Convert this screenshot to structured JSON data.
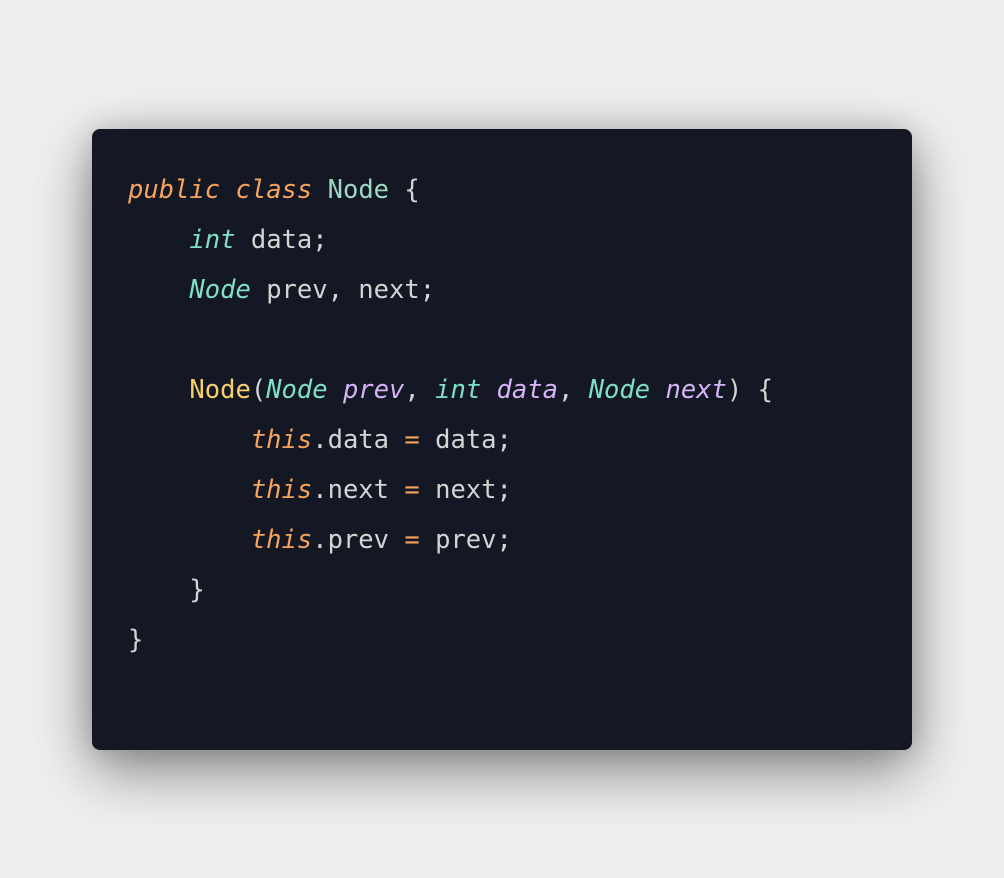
{
  "colors": {
    "background": "#141824",
    "keyword": "#f7a35c",
    "class": "#9dd8c2",
    "type": "#7fe0c6",
    "function": "#f8cf6a",
    "parameter": "#d7b3f7",
    "plain": "#d4d4d4"
  },
  "code_lines": [
    [
      [
        "keyword",
        "public"
      ],
      [
        "plain",
        " "
      ],
      [
        "keyword",
        "class"
      ],
      [
        "plain",
        " "
      ],
      [
        "class",
        "Node"
      ],
      [
        "plain",
        " {"
      ]
    ],
    [
      [
        "plain",
        "    "
      ],
      [
        "type",
        "int"
      ],
      [
        "plain",
        " data;"
      ]
    ],
    [
      [
        "plain",
        "    "
      ],
      [
        "type",
        "Node"
      ],
      [
        "plain",
        " prev, next;"
      ]
    ],
    [],
    [
      [
        "plain",
        "    "
      ],
      [
        "func",
        "Node"
      ],
      [
        "plain",
        "("
      ],
      [
        "type",
        "Node"
      ],
      [
        "plain",
        " "
      ],
      [
        "param",
        "prev"
      ],
      [
        "plain",
        ", "
      ],
      [
        "type",
        "int"
      ],
      [
        "plain",
        " "
      ],
      [
        "param",
        "data"
      ],
      [
        "plain",
        ", "
      ],
      [
        "type",
        "Node"
      ],
      [
        "plain",
        " "
      ],
      [
        "param",
        "next"
      ],
      [
        "plain",
        ") {"
      ]
    ],
    [
      [
        "plain",
        "        "
      ],
      [
        "keyword",
        "this"
      ],
      [
        "plain",
        ".data "
      ],
      [
        "op",
        "="
      ],
      [
        "plain",
        " data;"
      ]
    ],
    [
      [
        "plain",
        "        "
      ],
      [
        "keyword",
        "this"
      ],
      [
        "plain",
        ".next "
      ],
      [
        "op",
        "="
      ],
      [
        "plain",
        " next;"
      ]
    ],
    [
      [
        "plain",
        "        "
      ],
      [
        "keyword",
        "this"
      ],
      [
        "plain",
        ".prev "
      ],
      [
        "op",
        "="
      ],
      [
        "plain",
        " prev;"
      ]
    ],
    [
      [
        "plain",
        "    }"
      ]
    ],
    [
      [
        "plain",
        "}"
      ]
    ]
  ]
}
